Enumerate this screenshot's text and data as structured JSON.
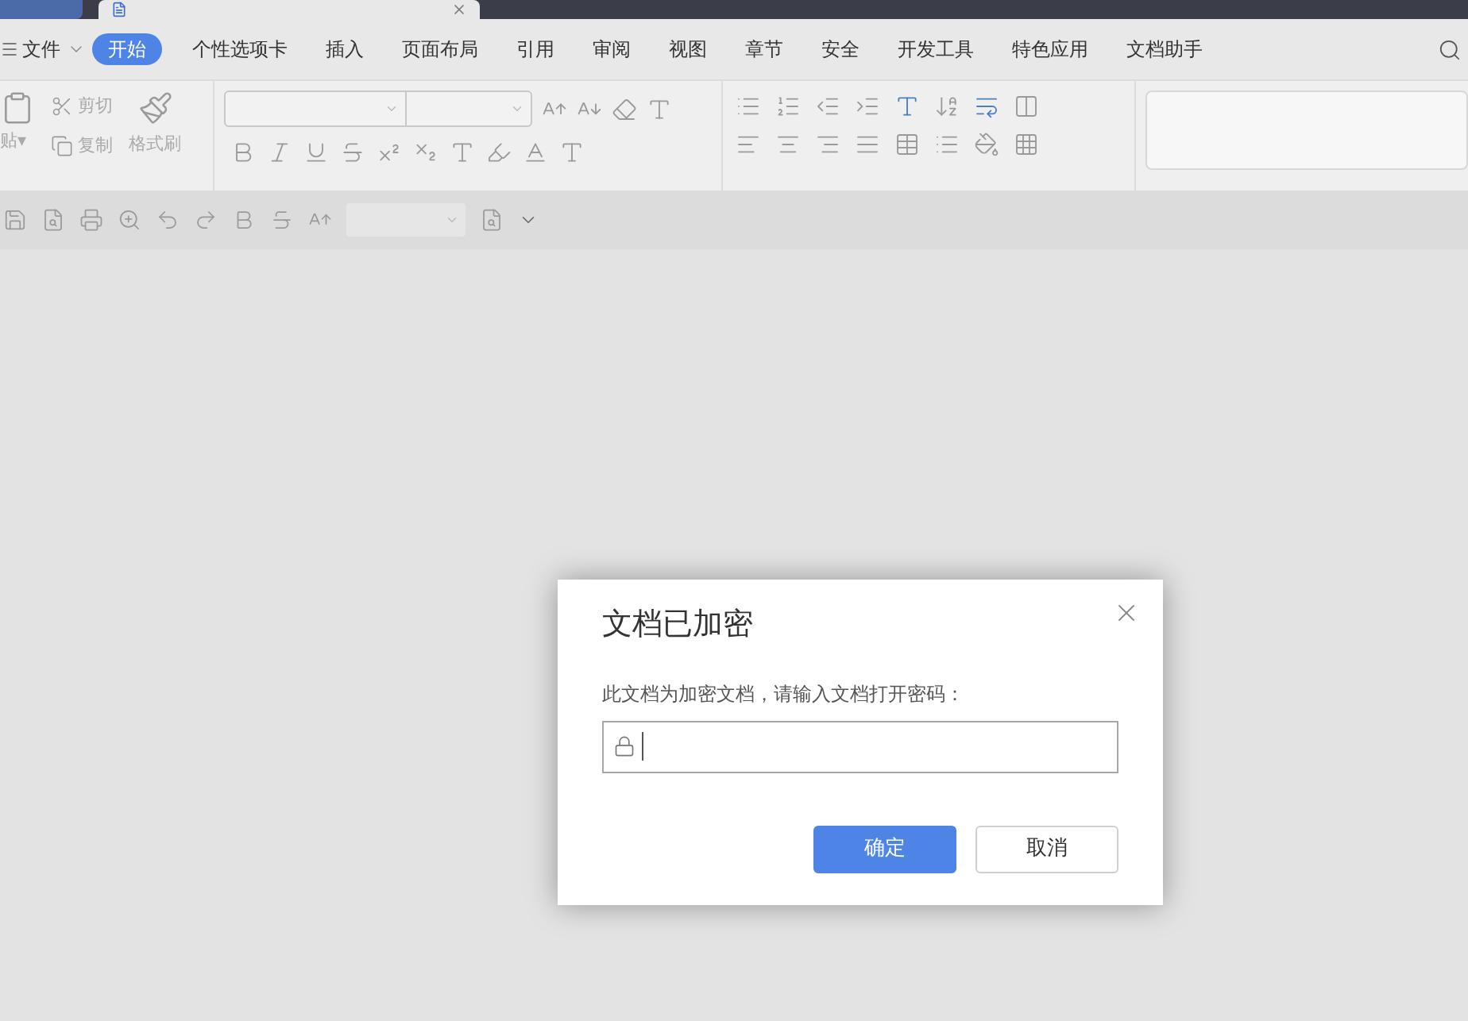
{
  "menu": {
    "file": "文件",
    "tabs": [
      {
        "label": "开始",
        "selected": true
      },
      {
        "label": "个性选项卡",
        "selected": false
      },
      {
        "label": "插入",
        "selected": false
      },
      {
        "label": "页面布局",
        "selected": false
      },
      {
        "label": "引用",
        "selected": false
      },
      {
        "label": "审阅",
        "selected": false
      },
      {
        "label": "视图",
        "selected": false
      },
      {
        "label": "章节",
        "selected": false
      },
      {
        "label": "安全",
        "selected": false
      },
      {
        "label": "开发工具",
        "selected": false
      },
      {
        "label": "特色应用",
        "selected": false
      },
      {
        "label": "文档助手",
        "selected": false
      }
    ]
  },
  "clipboard": {
    "paste": "贴",
    "paste_caret": "▾",
    "cut": "剪切",
    "copy": "复制",
    "format_painter": "格式刷"
  },
  "dialog": {
    "title": "文档已加密",
    "message": "此文档为加密文档，请输入文档打开密码：",
    "buttons": [
      {
        "label": "确定",
        "kind": "primary"
      },
      {
        "label": "取消",
        "kind": "secondary"
      }
    ]
  }
}
